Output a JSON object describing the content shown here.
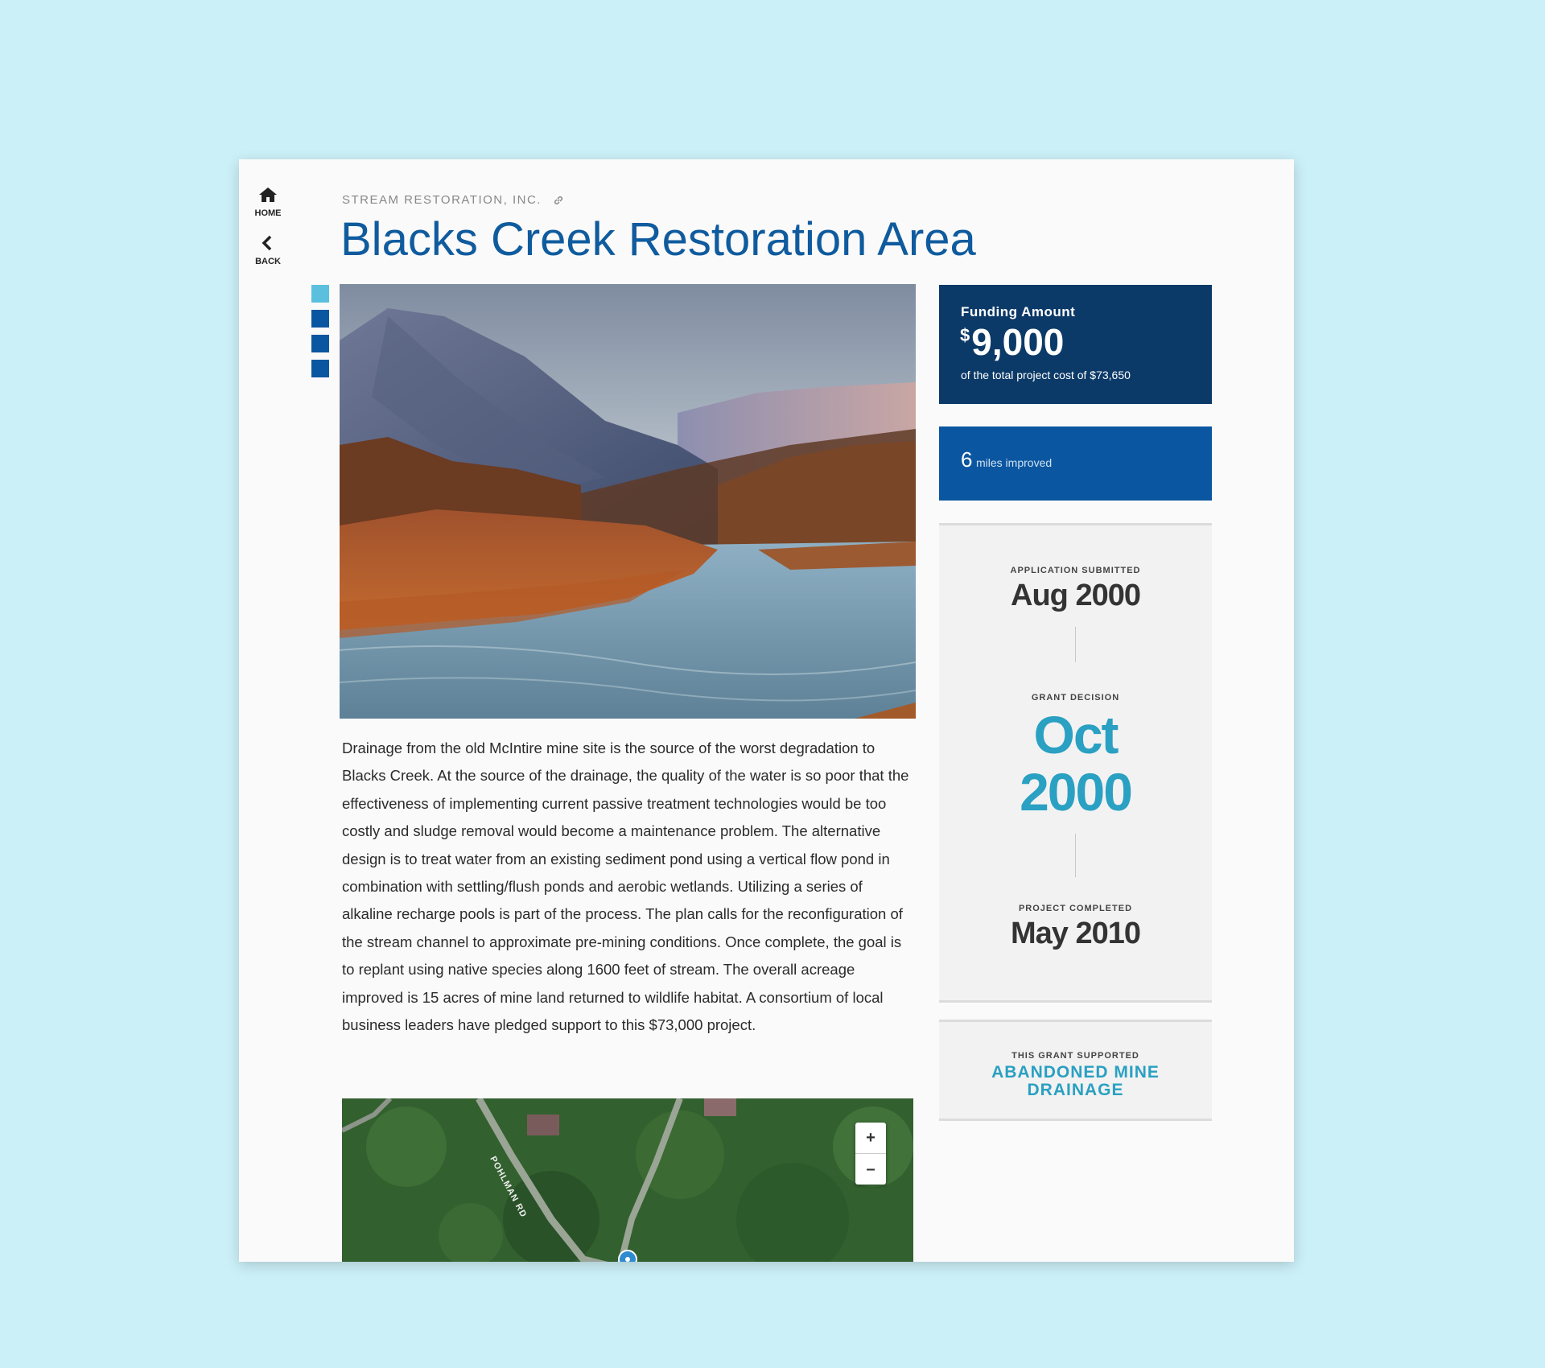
{
  "nav": {
    "home_label": "HOME",
    "back_label": "BACK"
  },
  "project": {
    "organization": "STREAM RESTORATION, INC.",
    "title": "Blacks Creek Restoration Area",
    "description": "Drainage from the old McIntire mine site is the source of the worst degradation to Blacks Creek. At the source of the drainage, the quality of the water is so poor that the effectiveness of implementing current passive treatment technologies would be too costly and sludge removal would become a maintenance problem. The alternative design is to treat water from an existing sediment pond using a vertical flow pond in combination with settling/flush ponds and aerobic wetlands. Utilizing a series of alkaline recharge pools is part of the process. The plan calls for the reconfiguration of the stream channel to approximate pre-mining conditions. Once complete, the goal is to replant using native species along 1600 feet of stream. The overall acreage improved is 15 acres of mine land returned to wildlife habitat. A consortium of local business leaders have pledged support to this $73,000 project."
  },
  "gallery": {
    "thumb_colors": [
      "#5bc0de",
      "#0b56a0",
      "#0b56a0",
      "#0b56a0"
    ],
    "active_index": 0
  },
  "funding": {
    "label": "Funding Amount",
    "currency_symbol": "$",
    "amount": "9,000",
    "note": "of the total project cost of $73,650"
  },
  "impact": {
    "number": "6",
    "unit": "miles improved"
  },
  "timeline": {
    "submitted_label": "APPLICATION SUBMITTED",
    "submitted_value": "Aug 2000",
    "decision_label": "GRANT DECISION",
    "decision_month": "Oct",
    "decision_year": "2000",
    "completed_label": "PROJECT COMPLETED",
    "completed_value": "May 2010"
  },
  "supported": {
    "label": "THIS GRANT SUPPORTED",
    "value": "ABANDONED MINE DRAINAGE"
  },
  "map": {
    "road_label": "POHLMAN RD",
    "zoom_in": "+",
    "zoom_out": "–"
  },
  "colors": {
    "title": "#0f5b9e",
    "funding_bg": "#0c3a68",
    "impact_bg": "#0b56a0",
    "accent": "#2aa0c2",
    "page_bg": "#ccf0f8"
  }
}
